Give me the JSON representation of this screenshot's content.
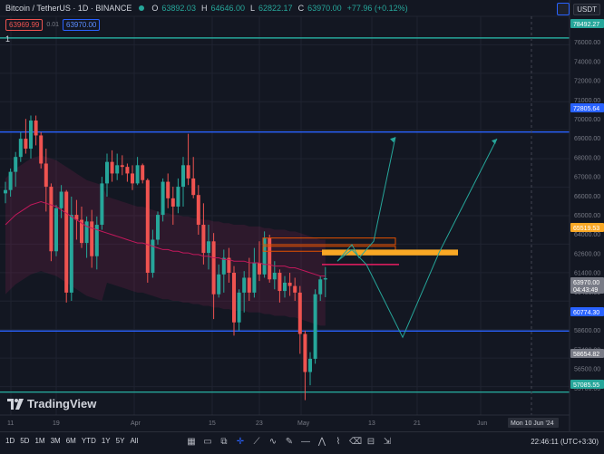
{
  "header": {
    "symbol": "Bitcoin / TetherUS · 1D · BINANCE",
    "open_label": "O",
    "open_value": "63892.03",
    "high_label": "H",
    "high_value": "64646.00",
    "low_label": "L",
    "low_value": "62822.17",
    "close_label": "C",
    "close_value": "63970.00",
    "change": "+77.96 (+0.12%)"
  },
  "bidask": {
    "sell": "63969.99",
    "spread": "0.01",
    "buy": "63970.00"
  },
  "quantity": "1",
  "currency": "USDT",
  "logo_text": "TradingView",
  "axis": {
    "price_ticks": [
      "78000.00",
      "76000.00",
      "74000.00",
      "72000.00",
      "71000.00",
      "70000.00",
      "69000.00",
      "68000.00",
      "67000.00",
      "66000.00",
      "65000.00",
      "64000.00",
      "62600.00",
      "61400.00",
      "60400.00",
      "59600.00",
      "58600.00",
      "57400.00",
      "56500.00",
      "55700.00"
    ],
    "labels": [
      {
        "text": "78492.27",
        "color": "#26a69a"
      },
      {
        "text": "72805.64",
        "color": "#2962ff"
      },
      {
        "text": "65519.53",
        "color": "#f9a825"
      },
      {
        "text": "63970.00",
        "color": "#787b86",
        "sub": "04:43:49"
      },
      {
        "text": "60774.30",
        "color": "#2962ff"
      },
      {
        "text": "58654.82",
        "color": "#787b86"
      },
      {
        "text": "57085.55",
        "color": "#26a69a"
      }
    ],
    "time_ticks": [
      "11",
      "19",
      "Apr",
      "15",
      "23",
      "May",
      "13",
      "21",
      "Jun"
    ],
    "time_highlight": "Mon 10 Jun '24"
  },
  "bottom": {
    "timeframes": [
      "1D",
      "5D",
      "1M",
      "3M",
      "6M",
      "YTD",
      "1Y",
      "5Y",
      "All"
    ],
    "tools": [
      "calendar-icon",
      "rectangle-icon",
      "bar-replay-icon",
      "crosshair-icon",
      "trendline-icon",
      "path-icon",
      "brush-icon",
      "horizontal-line-icon",
      "zigzag-icon",
      "polyline-icon",
      "eraser-icon",
      "ruler-icon",
      "measure-icon"
    ],
    "clock": "22:46:11 (UTC+3:30)"
  },
  "colors": {
    "up": "#26a69a",
    "down": "#ef5350",
    "accent": "#2962ff",
    "zone": "#f9a825"
  },
  "chart_data": {
    "type": "candlestick",
    "ylim": [
      55700,
      79800
    ],
    "candles": [
      {
        "o": 69100,
        "h": 69800,
        "l": 68500,
        "c": 69300
      },
      {
        "o": 69300,
        "h": 70600,
        "l": 68900,
        "c": 70400
      },
      {
        "o": 70400,
        "h": 71600,
        "l": 69500,
        "c": 71300
      },
      {
        "o": 71300,
        "h": 72800,
        "l": 71000,
        "c": 72400
      },
      {
        "o": 72400,
        "h": 73600,
        "l": 71500,
        "c": 71800
      },
      {
        "o": 71800,
        "h": 73800,
        "l": 71200,
        "c": 73500
      },
      {
        "o": 73500,
        "h": 73800,
        "l": 72000,
        "c": 72600
      },
      {
        "o": 72600,
        "h": 72800,
        "l": 70600,
        "c": 70900
      },
      {
        "o": 70900,
        "h": 71800,
        "l": 68000,
        "c": 69500
      },
      {
        "o": 69500,
        "h": 69700,
        "l": 65000,
        "c": 65600
      },
      {
        "o": 65600,
        "h": 68400,
        "l": 65300,
        "c": 68200
      },
      {
        "o": 68200,
        "h": 69600,
        "l": 67600,
        "c": 69200
      },
      {
        "o": 69200,
        "h": 69300,
        "l": 62500,
        "c": 63100
      },
      {
        "o": 63100,
        "h": 68900,
        "l": 62600,
        "c": 67800
      },
      {
        "o": 67800,
        "h": 68700,
        "l": 66300,
        "c": 67500
      },
      {
        "o": 67500,
        "h": 68300,
        "l": 65800,
        "c": 66100
      },
      {
        "o": 66100,
        "h": 67700,
        "l": 65200,
        "c": 67400
      },
      {
        "o": 67400,
        "h": 68100,
        "l": 64600,
        "c": 65300
      },
      {
        "o": 65300,
        "h": 67700,
        "l": 64500,
        "c": 67200
      },
      {
        "o": 67200,
        "h": 70100,
        "l": 66900,
        "c": 69700
      },
      {
        "o": 69700,
        "h": 71500,
        "l": 68900,
        "c": 71000
      },
      {
        "o": 71000,
        "h": 71700,
        "l": 69800,
        "c": 70300
      },
      {
        "o": 70300,
        "h": 71500,
        "l": 69900,
        "c": 70800
      },
      {
        "o": 70800,
        "h": 71400,
        "l": 70200,
        "c": 70700
      },
      {
        "o": 70700,
        "h": 70900,
        "l": 69800,
        "c": 70300
      },
      {
        "o": 70300,
        "h": 70800,
        "l": 69300,
        "c": 69700
      },
      {
        "o": 69700,
        "h": 71300,
        "l": 69600,
        "c": 70800
      },
      {
        "o": 70800,
        "h": 70900,
        "l": 69700,
        "c": 69900
      },
      {
        "o": 69900,
        "h": 70000,
        "l": 63700,
        "c": 64300
      },
      {
        "o": 64300,
        "h": 66900,
        "l": 64000,
        "c": 66300
      },
      {
        "o": 66300,
        "h": 68000,
        "l": 66000,
        "c": 67800
      },
      {
        "o": 67800,
        "h": 70000,
        "l": 67400,
        "c": 69800
      },
      {
        "o": 69800,
        "h": 70300,
        "l": 68200,
        "c": 68800
      },
      {
        "o": 68800,
        "h": 69500,
        "l": 67200,
        "c": 68300
      },
      {
        "o": 68300,
        "h": 70000,
        "l": 67900,
        "c": 69500
      },
      {
        "o": 69500,
        "h": 71300,
        "l": 68300,
        "c": 70800
      },
      {
        "o": 70800,
        "h": 72700,
        "l": 69600,
        "c": 70000
      },
      {
        "o": 70000,
        "h": 71300,
        "l": 68800,
        "c": 69000
      },
      {
        "o": 69000,
        "h": 69600,
        "l": 66600,
        "c": 67200
      },
      {
        "o": 67200,
        "h": 68500,
        "l": 64800,
        "c": 65500
      },
      {
        "o": 65500,
        "h": 67200,
        "l": 64500,
        "c": 66200
      },
      {
        "o": 66200,
        "h": 66700,
        "l": 61500,
        "c": 63000
      },
      {
        "o": 63000,
        "h": 64800,
        "l": 62800,
        "c": 64200
      },
      {
        "o": 64200,
        "h": 65700,
        "l": 63100,
        "c": 65200
      },
      {
        "o": 65200,
        "h": 65800,
        "l": 63700,
        "c": 64300
      },
      {
        "o": 64300,
        "h": 64700,
        "l": 60500,
        "c": 61300
      },
      {
        "o": 61300,
        "h": 63300,
        "l": 60800,
        "c": 63100
      },
      {
        "o": 63100,
        "h": 64400,
        "l": 61900,
        "c": 64000
      },
      {
        "o": 64000,
        "h": 65200,
        "l": 62600,
        "c": 63100
      },
      {
        "o": 63100,
        "h": 65800,
        "l": 62800,
        "c": 64900
      },
      {
        "o": 64900,
        "h": 66200,
        "l": 63800,
        "c": 64200
      },
      {
        "o": 64200,
        "h": 66800,
        "l": 64000,
        "c": 66400
      },
      {
        "o": 66400,
        "h": 66600,
        "l": 63700,
        "c": 63900
      },
      {
        "o": 63900,
        "h": 65000,
        "l": 63300,
        "c": 64300
      },
      {
        "o": 64300,
        "h": 64500,
        "l": 62500,
        "c": 63200
      },
      {
        "o": 63200,
        "h": 64100,
        "l": 62800,
        "c": 63700
      },
      {
        "o": 63700,
        "h": 64300,
        "l": 62900,
        "c": 63500
      },
      {
        "o": 63500,
        "h": 64000,
        "l": 62600,
        "c": 63100
      },
      {
        "o": 63100,
        "h": 63500,
        "l": 59400,
        "c": 60600
      },
      {
        "o": 60600,
        "h": 60800,
        "l": 56600,
        "c": 58300
      },
      {
        "o": 58300,
        "h": 59500,
        "l": 57500,
        "c": 59100
      },
      {
        "o": 59100,
        "h": 63300,
        "l": 58800,
        "c": 63000
      },
      {
        "o": 63000,
        "h": 64100,
        "l": 62600,
        "c": 63900
      },
      {
        "o": 63892.03,
        "h": 64646,
        "l": 62822.17,
        "c": 63970
      }
    ],
    "ma": [
      67200,
      67500,
      67800,
      68000,
      68200,
      68400,
      68500,
      68600,
      68500,
      68400,
      68300,
      68100,
      67900,
      67700,
      67500,
      67300,
      67100,
      67000,
      66900,
      66800,
      66700,
      66600,
      66500,
      66400,
      66300,
      66200,
      66100,
      66100,
      66000,
      65900,
      65800,
      65700,
      65700,
      65600,
      65600,
      65500,
      65500,
      65400,
      65400,
      65300,
      65300,
      65200,
      65200,
      65100,
      65100,
      65000,
      65000,
      65000,
      64900,
      64900,
      64900,
      64800,
      64800,
      64700,
      64700,
      64700,
      64600,
      64600,
      64500,
      64400,
      64300,
      64200,
      64100,
      64100
    ],
    "levels": [
      {
        "price": 78492.27,
        "color": "#26a69a"
      },
      {
        "price": 72805.64,
        "color": "#2962ff"
      },
      {
        "price": 60774.3,
        "color": "#2962ff"
      },
      {
        "price": 57085.55,
        "color": "#26a69a"
      }
    ],
    "zone": {
      "top": 65700,
      "bottom": 65350,
      "color": "#f9a825"
    },
    "projection_paths": [
      [
        [
          0,
          65000
        ],
        [
          2,
          66000
        ],
        [
          3,
          65200
        ],
        [
          5,
          66200
        ],
        [
          8,
          72500
        ]
      ],
      [
        [
          0,
          65000
        ],
        [
          2,
          65700
        ],
        [
          4,
          64800
        ],
        [
          9,
          60400
        ],
        [
          14,
          65500
        ],
        [
          22,
          72400
        ]
      ]
    ],
    "up_target_labels": []
  }
}
